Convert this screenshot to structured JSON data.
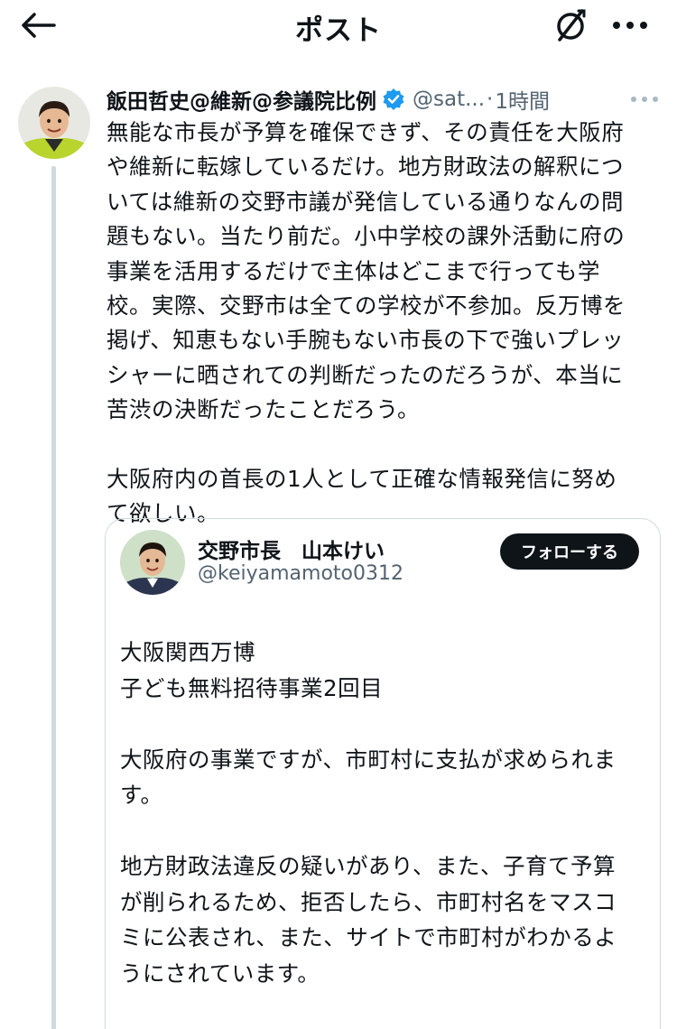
{
  "topbar": {
    "title": "ポスト"
  },
  "post": {
    "author_name": "飯田哲史@維新@参議院比例",
    "handle": "@sat...",
    "separator": "·",
    "time": "1時間",
    "text": "無能な市長が予算を確保できず、その責任を大阪府\nや維新に転嫁しているだけ。地方財政法の解釈につ\nいては維新の交野市議が発信している通りなんの問\n題もない。当たり前だ。小中学校の課外活動に府の\n事業を活用するだけで主体はどこまで行っても学\n校。実際、交野市は全ての学校が不参加。反万博を\n掲げ、知恵もない手腕もない市長の下で強いプレッ\nシャーに晒されての判断だったのだろうが、本当に\n苦渋の決断だったことだろう。\n\n大阪府内の首長の1人として正確な情報発信に努め\nて欲しい。"
  },
  "quoted": {
    "author_name": "交野市長　山本けい",
    "handle": "@keiyamamoto0312",
    "follow_label": "フォローする",
    "text": "大阪関西万博\n子ども無料招待事業2回目\n\n大阪府の事業ですが、市町村に支払が求められま\nす。\n\n地方財政法違反の疑いがあり、また、子育て予算\nが削られるため、拒否したら、市町村名をマスコ\nミに公表され、また、サイトで市町村がわかるよ\nうにされています。"
  },
  "colors": {
    "text": "#0f1419",
    "muted": "#536471",
    "verified": "#1d9bf0",
    "border": "#cfd9de",
    "follow_bg": "#0f1419"
  },
  "icons": {
    "back": "arrow-left-icon",
    "grok": "grok-icon",
    "more": "more-horizontal-icon",
    "verified": "verified-badge-icon"
  }
}
